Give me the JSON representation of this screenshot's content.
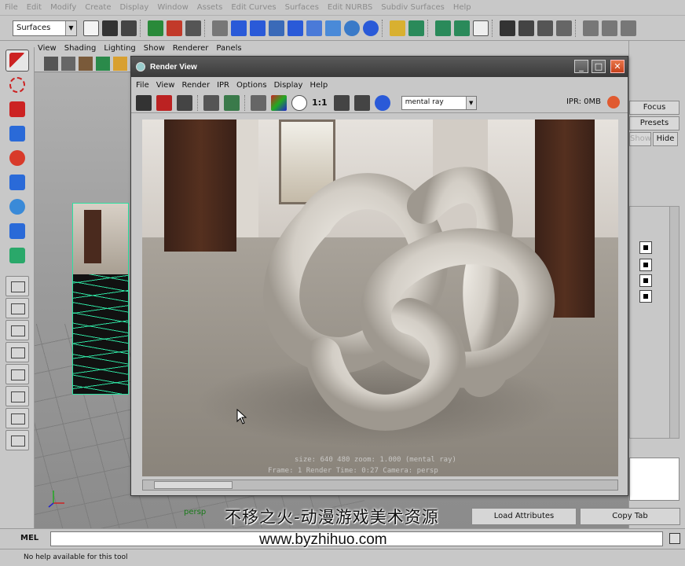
{
  "main_menu": [
    "File",
    "Edit",
    "Modify",
    "Create",
    "Display",
    "Window",
    "Assets",
    "Edit Curves",
    "Surfaces",
    "Edit NURBS",
    "Subdiv Surfaces",
    "Help"
  ],
  "status_line": {
    "menu_set": "Surfaces"
  },
  "viewport": {
    "menu": [
      "View",
      "Shading",
      "Lighting",
      "Show",
      "Renderer",
      "Panels"
    ],
    "camera_label": "persp"
  },
  "attribute_editor": {
    "focus": "Focus",
    "presets": "Presets",
    "show": "Show",
    "hide": "Hide",
    "load_attributes": "Load Attributes",
    "copy_tab": "Copy Tab"
  },
  "render_view": {
    "title": "Render View",
    "menu": [
      "File",
      "View",
      "Render",
      "IPR",
      "Options",
      "Display",
      "Help"
    ],
    "ratio_label": "1:1",
    "renderer": "mental ray",
    "ipr_status": "IPR: 0MB",
    "info_line1": "size: 640  480 zoom: 1.000     (mental ray)",
    "info_line2": "Frame: 1     Render Time: 0:27      Camera: persp",
    "colors": {
      "title_bar": "#454545",
      "close_button": "#d9582c",
      "floor": "#958f86",
      "knot": "#e4e0da"
    }
  },
  "command_line": {
    "label": "MEL",
    "value": ""
  },
  "help_line": "No help available for this tool",
  "watermark": {
    "chinese": "不移之火-动漫游戏美术资源",
    "url": "www.byzhihuo.com"
  }
}
